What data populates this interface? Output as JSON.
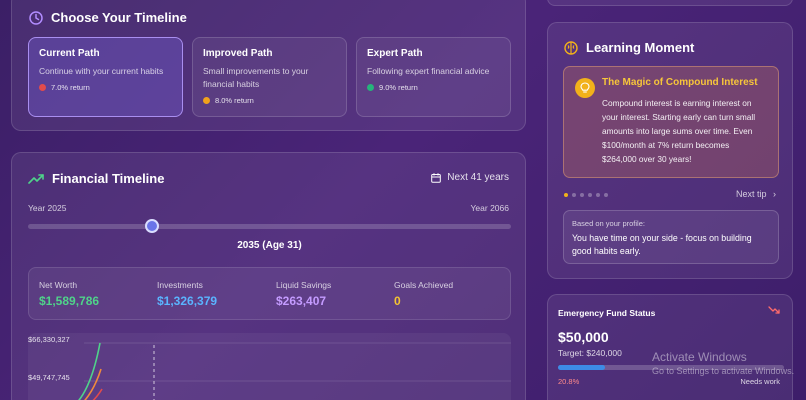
{
  "choose": {
    "title": "Choose Your Timeline",
    "paths": [
      {
        "name": "Current Path",
        "desc": "Continue with your current habits",
        "return": "7.0% return",
        "dot": "#e24b4b"
      },
      {
        "name": "Improved Path",
        "desc": "Small improvements to your financial habits",
        "return": "8.0% return",
        "dot": "#f0a21c"
      },
      {
        "name": "Expert Path",
        "desc": "Following expert financial advice",
        "return": "9.0% return",
        "dot": "#26b37b"
      }
    ]
  },
  "timeline": {
    "title": "Financial Timeline",
    "next": "Next 41 years",
    "start": "Year 2025",
    "end": "Year 2066",
    "selected": "2035 (Age 31)",
    "stats": [
      {
        "label": "Net Worth",
        "value": "$1,589,786",
        "color": "#4fd38a"
      },
      {
        "label": "Investments",
        "value": "$1,326,379",
        "color": "#5ab4ff"
      },
      {
        "label": "Liquid Savings",
        "value": "$263,407",
        "color": "#c49bff"
      },
      {
        "label": "Goals Achieved",
        "value": "0",
        "color": "#f4c431"
      }
    ],
    "chart_ticks": [
      "$66,330,327",
      "$49,747,745"
    ]
  },
  "learn": {
    "title": "Learning Moment",
    "tip_title": "The Magic of Compound Interest",
    "tip_body": "Compound interest is earning interest on your interest. Starting early can turn small amounts into large sums over time. Even $100/month at 7% return becomes $264,000 over 30 years!",
    "next_tip": "Next tip",
    "profile_label": "Based on your profile:",
    "profile_msg": "You have time on your side - focus on building good habits early."
  },
  "emergency": {
    "title": "Emergency Fund Status",
    "amount": "$50,000",
    "target": "Target: $240,000",
    "progress": 0.208,
    "percent": "20.8%",
    "status": "Needs work"
  },
  "watermark": {
    "line1": "Activate Windows",
    "line2": "Go to Settings to activate Windows."
  }
}
